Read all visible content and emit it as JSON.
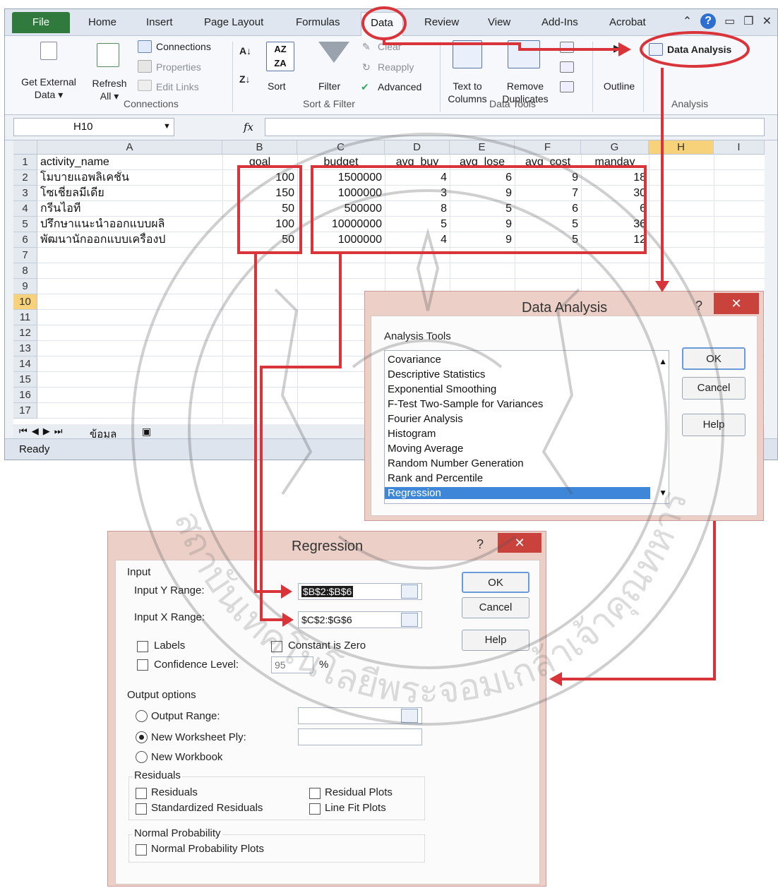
{
  "ribbon": {
    "tabs": [
      "File",
      "Home",
      "Insert",
      "Page Layout",
      "Formulas",
      "Data",
      "Review",
      "View",
      "Add-Ins",
      "Acrobat"
    ],
    "active_tab": "Data",
    "get_external_data": "Get External\nData ▾",
    "refresh_all": "Refresh\nAll ▾",
    "connections": "Connections",
    "properties": "Properties",
    "edit_links": "Edit Links",
    "group_connections": "Connections",
    "sort": "Sort",
    "filter": "Filter",
    "clear": "Clear",
    "reapply": "Reapply",
    "advanced": "Advanced",
    "group_sort_filter": "Sort & Filter",
    "text_to_columns": "Text to\nColumns",
    "remove_duplicates": "Remove\nDuplicates",
    "group_data_tools": "Data Tools",
    "outline": "Outline",
    "data_analysis": "Data Analysis",
    "group_analysis": "Analysis"
  },
  "formula_bar": {
    "name_box": "H10",
    "fx": "fx",
    "formula": ""
  },
  "sheet": {
    "columns": [
      "A",
      "B",
      "C",
      "D",
      "E",
      "F",
      "G",
      "H",
      "I"
    ],
    "selected_column": "H",
    "rows": [
      "1",
      "2",
      "3",
      "4",
      "5",
      "6",
      "7",
      "8",
      "9",
      "10",
      "11",
      "12",
      "13",
      "14",
      "15",
      "16",
      "17"
    ],
    "selected_row": "10",
    "header": [
      "activity_name",
      "goal",
      "budget",
      "avg_buy",
      "avg_lose",
      "avg_cost",
      "manday"
    ],
    "data": [
      [
        "โมบายแอพลิเคชั่น",
        "100",
        "1500000",
        "4",
        "6",
        "9",
        "18"
      ],
      [
        "โซเชี่ยลมีเดีย",
        "150",
        "1000000",
        "3",
        "9",
        "7",
        "30"
      ],
      [
        "กรีนไอที",
        "50",
        "500000",
        "8",
        "5",
        "6",
        "6"
      ],
      [
        "ปรึกษาแนะนำออกแบบผลิ",
        "100",
        "10000000",
        "5",
        "9",
        "5",
        "36"
      ],
      [
        "พัฒนานักออกแบบเครื่องป",
        "50",
        "1000000",
        "4",
        "9",
        "5",
        "12"
      ]
    ],
    "sheet_tab": "ข้อมูล",
    "status": "Ready"
  },
  "data_analysis_dialog": {
    "title": "Data Analysis",
    "help_glyph": "?",
    "close_glyph": "✕",
    "section_label": "Analysis Tools",
    "tools": [
      "Covariance",
      "Descriptive Statistics",
      "Exponential Smoothing",
      "F-Test Two-Sample for Variances",
      "Fourier Analysis",
      "Histogram",
      "Moving Average",
      "Random Number Generation",
      "Rank and Percentile",
      "Regression"
    ],
    "selected_tool": "Regression",
    "ok": "OK",
    "cancel": "Cancel",
    "help": "Help"
  },
  "regression_dialog": {
    "title": "Regression",
    "help_glyph": "?",
    "close_glyph": "✕",
    "input_label": "Input",
    "input_y_label": "Input Y Range:",
    "input_y_value": "$B$2:$B$6",
    "input_x_label": "Input X Range:",
    "input_x_value": "$C$2:$G$6",
    "labels": "Labels",
    "constant_zero": "Constant is Zero",
    "confidence_level": "Confidence Level:",
    "confidence_value": "95",
    "percent": "%",
    "output_options": "Output options",
    "output_range": "Output Range:",
    "new_worksheet_ply": "New Worksheet Ply:",
    "new_workbook": "New Workbook",
    "residuals_group": "Residuals",
    "residuals": "Residuals",
    "standardized_residuals": "Standardized Residuals",
    "residual_plots": "Residual Plots",
    "line_fit_plots": "Line Fit Plots",
    "normal_probability_group": "Normal Probability",
    "normal_probability_plots": "Normal Probability Plots",
    "ok": "OK",
    "cancel": "Cancel",
    "help": "Help",
    "selected_output": "New Worksheet Ply"
  },
  "watermark": {
    "text": "สถาบันเทคโนโลยีพระจอมเกล้าเจ้าคุณทหาร"
  },
  "colors": {
    "annotation_red": "#d9343a",
    "excel_green": "#2f7a3c",
    "selection_blue": "#3d86d8",
    "highlight_header": "#f7d27a"
  }
}
